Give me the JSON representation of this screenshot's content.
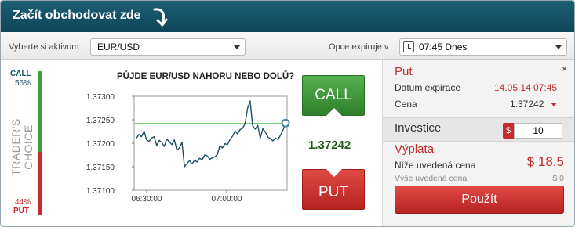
{
  "header": {
    "title": "Začít obchodovat zde"
  },
  "selectors": {
    "asset_label": "Vyberte si aktivum:",
    "asset_value": "EUR/USD",
    "expiry_label": "Opce expiruje v",
    "expiry_value": "07:45 Dnes"
  },
  "traders_choice": {
    "title": "TRADER'S CHOICE",
    "call_label": "CALL",
    "call_pct": "56%",
    "put_pct": "44%",
    "put_label": "PUT",
    "call_fraction": 0.56
  },
  "chart_title": "PŮJDE EUR/USD NAHORU NEBO DOLŮ?",
  "chart_data": {
    "type": "line",
    "title": "PŮJDE EUR/USD NAHORU NEBO DOLŮ?",
    "xlabel": "",
    "ylabel": "",
    "x_tick_labels": [
      "06:30:00",
      "07:00:00"
    ],
    "y_tick_labels": [
      "1.37300",
      "1.37250",
      "1.37200",
      "1.37150",
      "1.37100"
    ],
    "ylim": [
      1.371,
      1.373
    ],
    "reference_line": 1.37242,
    "grid": false,
    "colors": {
      "line": "#1e4f63",
      "reference": "#7fd07a",
      "marker": "#4f86a6"
    },
    "series": [
      {
        "values": [
          1.37211,
          1.37219,
          1.37214,
          1.37226,
          1.37207,
          1.37204,
          1.37211,
          1.37214,
          1.37195,
          1.37206,
          1.37202,
          1.37193,
          1.37209,
          1.37203,
          1.37197,
          1.37207,
          1.37185,
          1.3719,
          1.37202,
          1.3715,
          1.37157,
          1.37163,
          1.37156,
          1.37164,
          1.3716,
          1.37168,
          1.37165,
          1.37175,
          1.37173,
          1.37166,
          1.37169,
          1.37171,
          1.37176,
          1.37195,
          1.3719,
          1.37199,
          1.37197,
          1.37208,
          1.37215,
          1.37226,
          1.3722,
          1.37229,
          1.37232,
          1.37242,
          1.37275,
          1.3729,
          1.37237,
          1.3723,
          1.37238,
          1.37211,
          1.37231,
          1.37224,
          1.37213,
          1.3721,
          1.37205,
          1.37211,
          1.37208,
          1.37217,
          1.37228,
          1.37243
        ]
      }
    ]
  },
  "buttons": {
    "call": "CALL",
    "put": "PUT"
  },
  "current_price": "1.37242",
  "panel": {
    "type_label": "Put",
    "expiry_label": "Datum expirace",
    "expiry_value": "14.05.14 07:45",
    "price_label": "Cena",
    "price_value": "1.37242",
    "investment_label": "Investice",
    "currency": "$",
    "investment_value": "10",
    "payout_label": "Výplata",
    "below_label": "Níže uvedená cena",
    "below_value": "$ 18.5",
    "above_label": "Výše uvedená cena",
    "above_value": "$ 0",
    "submit_label": "Použít",
    "close_label": "×"
  }
}
